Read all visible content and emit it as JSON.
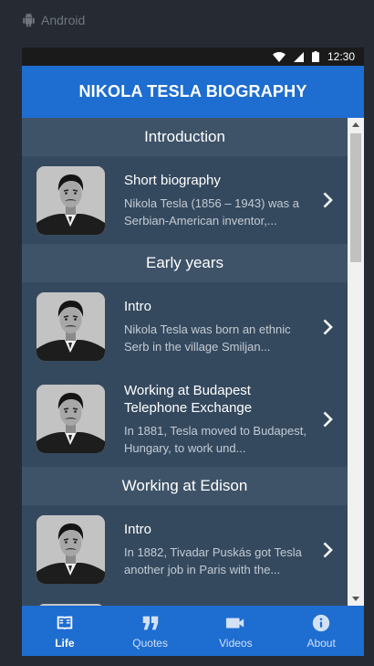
{
  "host": {
    "platform_label": "Android",
    "platform_icon": "android-icon"
  },
  "status_bar": {
    "time": "12:30"
  },
  "app_bar": {
    "title": "NIKOLA TESLA BIOGRAPHY"
  },
  "sections": [
    {
      "header": "Introduction",
      "items": [
        {
          "title": "Short biography",
          "description": "Nikola Tesla (1856 – 1943) was a Serbian-American inventor,..."
        }
      ]
    },
    {
      "header": "Early years",
      "items": [
        {
          "title": "Intro",
          "description": "Nikola Tesla was born an ethnic Serb in the village Smiljan..."
        },
        {
          "title": "Working at Budapest Telephone Exchange",
          "description": "In 1881, Tesla moved to Budapest, Hungary, to work und..."
        }
      ]
    },
    {
      "header": "Working at Edison",
      "items": [
        {
          "title": "Intro",
          "description": "In 1882, Tivadar Puskás got Tesla another job in Paris with the..."
        }
      ]
    }
  ],
  "tabs": [
    {
      "label": "Life",
      "icon": "book-icon",
      "active": true
    },
    {
      "label": "Quotes",
      "icon": "quote-icon",
      "active": false
    },
    {
      "label": "Videos",
      "icon": "video-camera-icon",
      "active": false
    },
    {
      "label": "About",
      "icon": "info-icon",
      "active": false
    }
  ],
  "colors": {
    "app_bar": "#1e6dd0",
    "list_bg": "#35495e",
    "section_header_bg": "#3e5368",
    "page_bg": "#262b33"
  }
}
